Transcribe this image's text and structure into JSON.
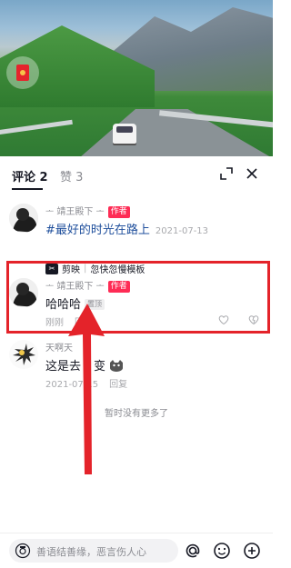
{
  "tabs": {
    "comments": "评论 2",
    "likes": "赞 3"
  },
  "comments": [
    {
      "name": "ᅩ 靖王殿下 ᅩ",
      "badge": "作者",
      "text": "#最好的时光在路上",
      "date": "2021-07-13",
      "template_app": "剪映",
      "template_sep": "|",
      "template_text": "忽快忽慢模板"
    },
    {
      "name": "ᅩ 靖王殿下 ᅩ",
      "badge": "作者",
      "text": "哈哈哈",
      "read_badge": "置顶",
      "time": "刚刚",
      "reply": "回复"
    },
    {
      "name": "天啊天",
      "text": "这是去",
      "text_tail": "变",
      "date": "2021-07-15",
      "reply": "回复"
    }
  ],
  "no_more": "暂时没有更多了",
  "input": {
    "placeholder": "善语结善缘，恶言伤人心"
  },
  "icons": [
    "red-packet-icon",
    "expand-icon",
    "close-icon",
    "heart-icon",
    "dislike-icon",
    "camera-icon",
    "at-icon",
    "emoji-icon",
    "add-icon"
  ],
  "colors": {
    "accent": "#fe2c55",
    "annotation": "#e4232a",
    "tag_link": "#1f4f9c"
  }
}
